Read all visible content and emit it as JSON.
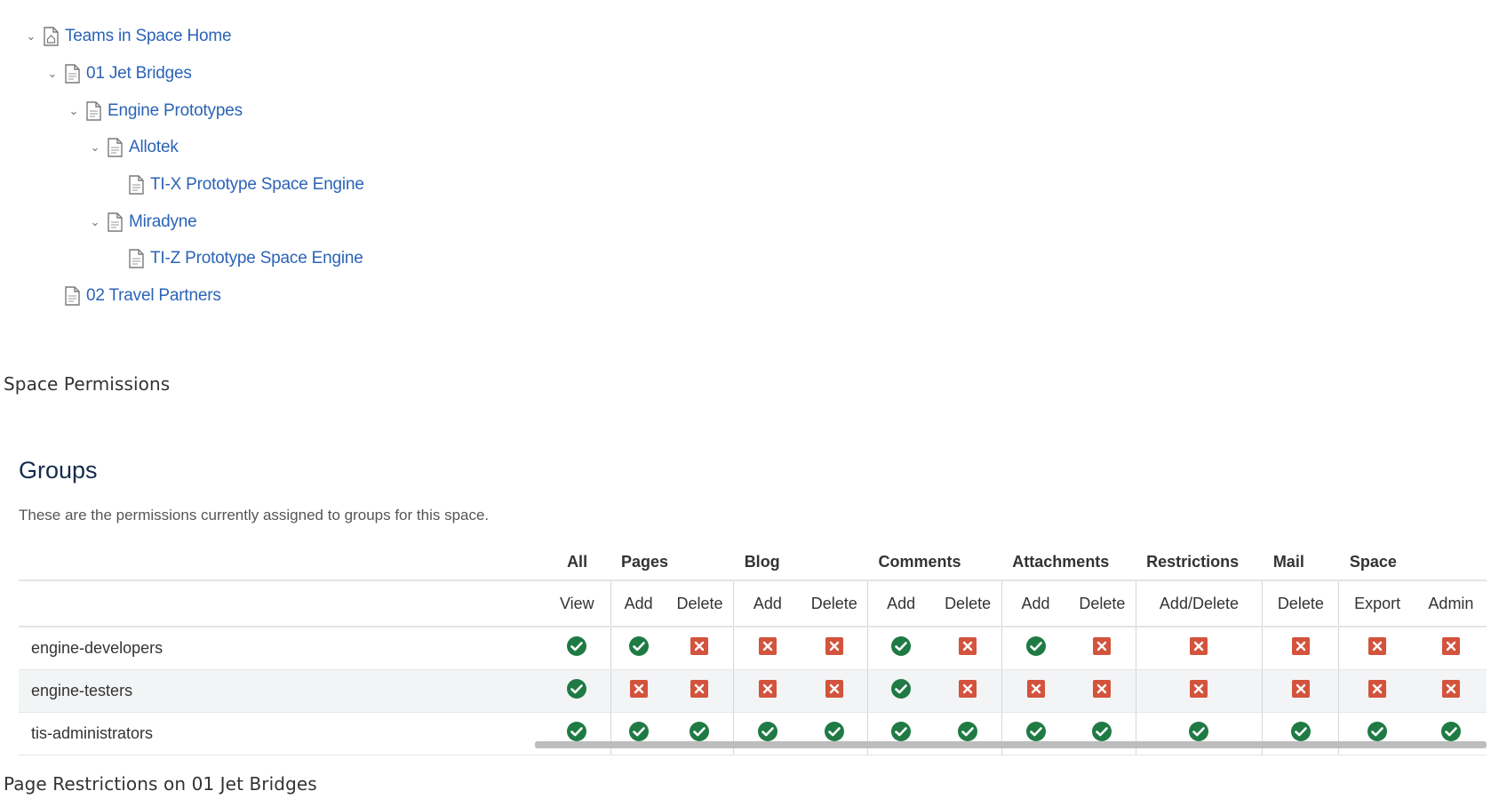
{
  "tree": [
    {
      "label": "Teams in Space Home",
      "expanded": true,
      "icon": "home-page-icon"
    },
    {
      "label": "01 Jet Bridges",
      "expanded": true,
      "icon": "page-icon"
    },
    {
      "label": "Engine Prototypes",
      "expanded": true,
      "icon": "page-icon"
    },
    {
      "label": "Allotek",
      "expanded": true,
      "icon": "page-icon"
    },
    {
      "label": "TI-X Prototype Space Engine",
      "expanded": false,
      "icon": "page-icon"
    },
    {
      "label": "Miradyne",
      "expanded": true,
      "icon": "page-icon"
    },
    {
      "label": "TI-Z Prototype Space Engine",
      "expanded": false,
      "icon": "page-icon"
    },
    {
      "label": "02 Travel Partners",
      "expanded": false,
      "icon": "page-icon"
    }
  ],
  "space_permissions_label": "Space Permissions",
  "groups": {
    "title": "Groups",
    "description": "These are the permissions currently assigned to groups for this space."
  },
  "permissions": {
    "categories": [
      "All",
      "Pages",
      "Blog",
      "Comments",
      "Attachments",
      "Restrictions",
      "Mail",
      "Space"
    ],
    "subheaders": [
      "View",
      "Add",
      "Delete",
      "Add",
      "Delete",
      "Add",
      "Delete",
      "Add",
      "Delete",
      "Add/Delete",
      "Delete",
      "Export",
      "Admin"
    ],
    "rows": [
      {
        "group": "engine-developers",
        "values": [
          true,
          true,
          false,
          false,
          false,
          true,
          false,
          true,
          false,
          false,
          false,
          false,
          false
        ]
      },
      {
        "group": "engine-testers",
        "values": [
          true,
          false,
          false,
          false,
          false,
          true,
          false,
          false,
          false,
          false,
          false,
          false,
          false
        ]
      },
      {
        "group": "tis-administrators",
        "values": [
          true,
          true,
          true,
          true,
          true,
          true,
          true,
          true,
          true,
          true,
          true,
          true,
          true
        ]
      }
    ]
  },
  "page_restrictions_label": "Page Restrictions on 01 Jet Bridges",
  "colors": {
    "granted": "#1f7a44",
    "denied": "#d3533d",
    "link": "#2b63b7"
  }
}
